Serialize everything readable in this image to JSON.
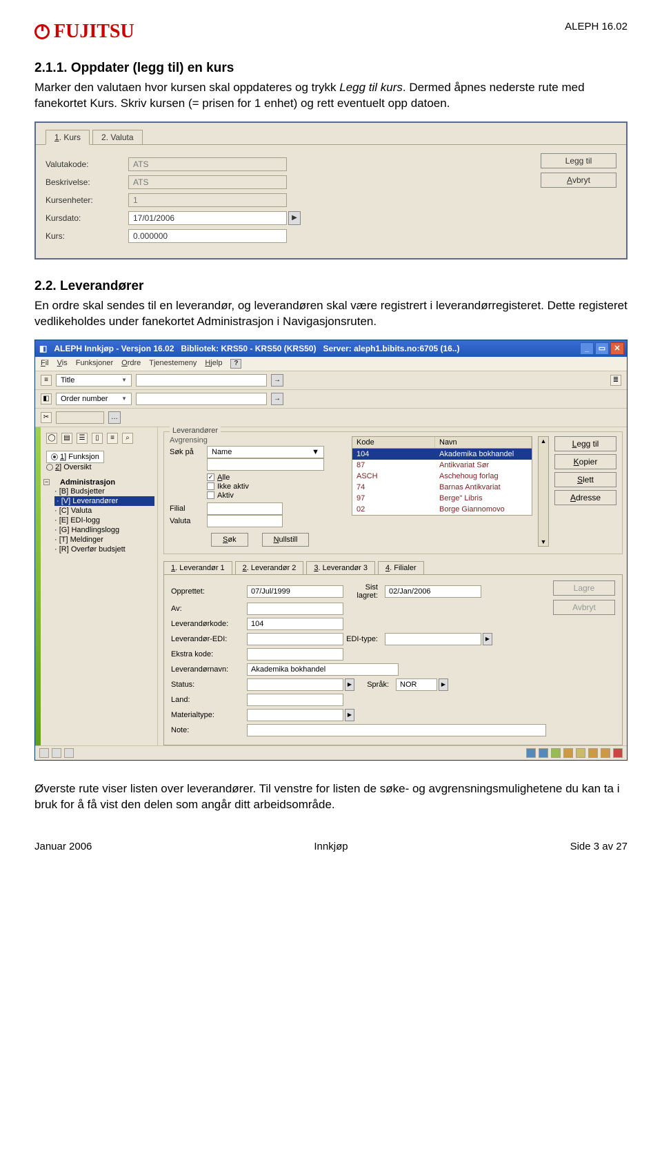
{
  "header": {
    "brand": "FUJITSU",
    "doc_version": "ALEPH 16.02"
  },
  "section1": {
    "heading": "2.1.1.  Oppdater (legg til) en kurs",
    "para_a": "Marker den valutaen hvor kursen skal oppdateres og trykk ",
    "para_b": "Legg til kurs",
    "para_c": ". Dermed åpnes nederste rute med fanekortet Kurs. Skriv kursen (= prisen for 1 enhet) og rett eventuelt opp datoen."
  },
  "shot1": {
    "tab1_u": "1",
    "tab1_t": ". Kurs",
    "tab2": "2. Valuta",
    "fields": {
      "valutakode": {
        "lbl": "Valutakode:",
        "val": "ATS"
      },
      "beskrivelse": {
        "lbl": "Beskrivelse:",
        "val": "ATS"
      },
      "kursenheter": {
        "lbl": "Kursenheter:",
        "val": "1"
      },
      "kursdato": {
        "lbl": "Kursdato:",
        "val": "17/01/2006"
      },
      "kurs": {
        "lbl": "Kurs:",
        "val": "0.000000"
      }
    },
    "btn_leggtil": "Legg til",
    "btn_avbryt_u": "A",
    "btn_avbryt_t": "vbryt"
  },
  "section2": {
    "heading": "2.2. Leverandører",
    "para": "En ordre skal sendes til en leverandør, og leverandøren skal være registrert i leverandørregisteret. Dette registeret vedlikeholdes under fanekortet Administrasjon i Navigasjonsruten."
  },
  "app": {
    "title": "ALEPH Innkjøp - Versjon 16.02",
    "lib": "Bibliotek:  KRS50 - KRS50 (KRS50)",
    "srv": "Server:  aleph1.bibits.no:6705 (16..)",
    "menu": {
      "m1u": "F",
      "m1t": "il",
      "m2u": "V",
      "m2t": "is",
      "m3": "Funksjoner",
      "m4u": "O",
      "m4t": "rdre",
      "m5": "Tjenestemeny",
      "m6u": "H",
      "m6t": "jelp"
    },
    "toolbar": {
      "sel1": "Title",
      "sel2": "Order number"
    },
    "nav": {
      "radio1u": "1",
      "radio1t": "] Funksjon",
      "radio2u": "2",
      "radio2t": "] Oversikt",
      "root": "Administrasjon",
      "items": [
        "[B] Budsjetter",
        "[V] Leverandører",
        "[C] Valuta",
        "[E] EDI-logg",
        "[G] Handlingslogg",
        "[T] Meldinger",
        "[R] Overfør budsjett"
      ],
      "selected_index": 1
    },
    "filters": {
      "group": "Leverandører",
      "sub": "Avgrensing",
      "sok": "Søk på",
      "sok_val": "Name",
      "alle_u": "A",
      "alle_t": "lle",
      "ikke": "Ikke aktiv",
      "aktiv": "Aktiv",
      "filial": "Filial",
      "valuta": "Valuta",
      "btn_sok_u": "S",
      "btn_sok_t": "øk",
      "btn_null_u": "N",
      "btn_null_t": "ullstill"
    },
    "list": {
      "col_kode": "Kode",
      "col_navn": "Navn",
      "rows": [
        {
          "kode": "104",
          "navn": "Akademika bokhandel"
        },
        {
          "kode": "87",
          "navn": "Antikvariat Sør"
        },
        {
          "kode": "ASCH",
          "navn": "Aschehoug forlag"
        },
        {
          "kode": "74",
          "navn": "Barnas Antikvariat"
        },
        {
          "kode": "97",
          "navn": "Berge\" Libris"
        },
        {
          "kode": "02",
          "navn": "Borge  Giannomovo"
        }
      ],
      "selected_index": 0,
      "btns": [
        "Legg til",
        "Kopier",
        "Slett",
        "Adresse"
      ],
      "btns_u": [
        "L",
        "K",
        "S",
        "A"
      ]
    },
    "detail": {
      "tabs": [
        "1. Leverandør 1",
        "2. Leverandør 2",
        "3. Leverandør 3",
        "4. Filialer"
      ],
      "tab_u": [
        "1",
        "2",
        "3",
        "4"
      ],
      "opprettet_l": "Opprettet:",
      "opprettet": "07/Jul/1999",
      "sist_l": "Sist lagret:",
      "sist": "02/Jan/2006",
      "av_l": "Av:",
      "kode_l": "Leverandørkode:",
      "kode": "104",
      "edi_l": "Leverandør-EDI:",
      "editype_l": "EDI-type:",
      "ekstra_l": "Ekstra kode:",
      "navn_l": "Leverandørnavn:",
      "navn": "Akademika bokhandel",
      "status_l": "Status:",
      "sprak_l": "Språk:",
      "sprak": "NOR",
      "land_l": "Land:",
      "mat_l": "Materialtype:",
      "note_l": "Note:",
      "btn_lagre": "Lagre",
      "btn_avbryt": "Avbryt"
    }
  },
  "section3": {
    "para": "Øverste rute viser listen over leverandører. Til venstre for listen de søke- og avgrensningsmulighetene du kan ta i bruk for å få vist den delen som angår ditt arbeidsområde."
  },
  "footer": {
    "left": "Januar 2006",
    "mid": "Innkjøp",
    "right": "Side 3 av 27"
  }
}
